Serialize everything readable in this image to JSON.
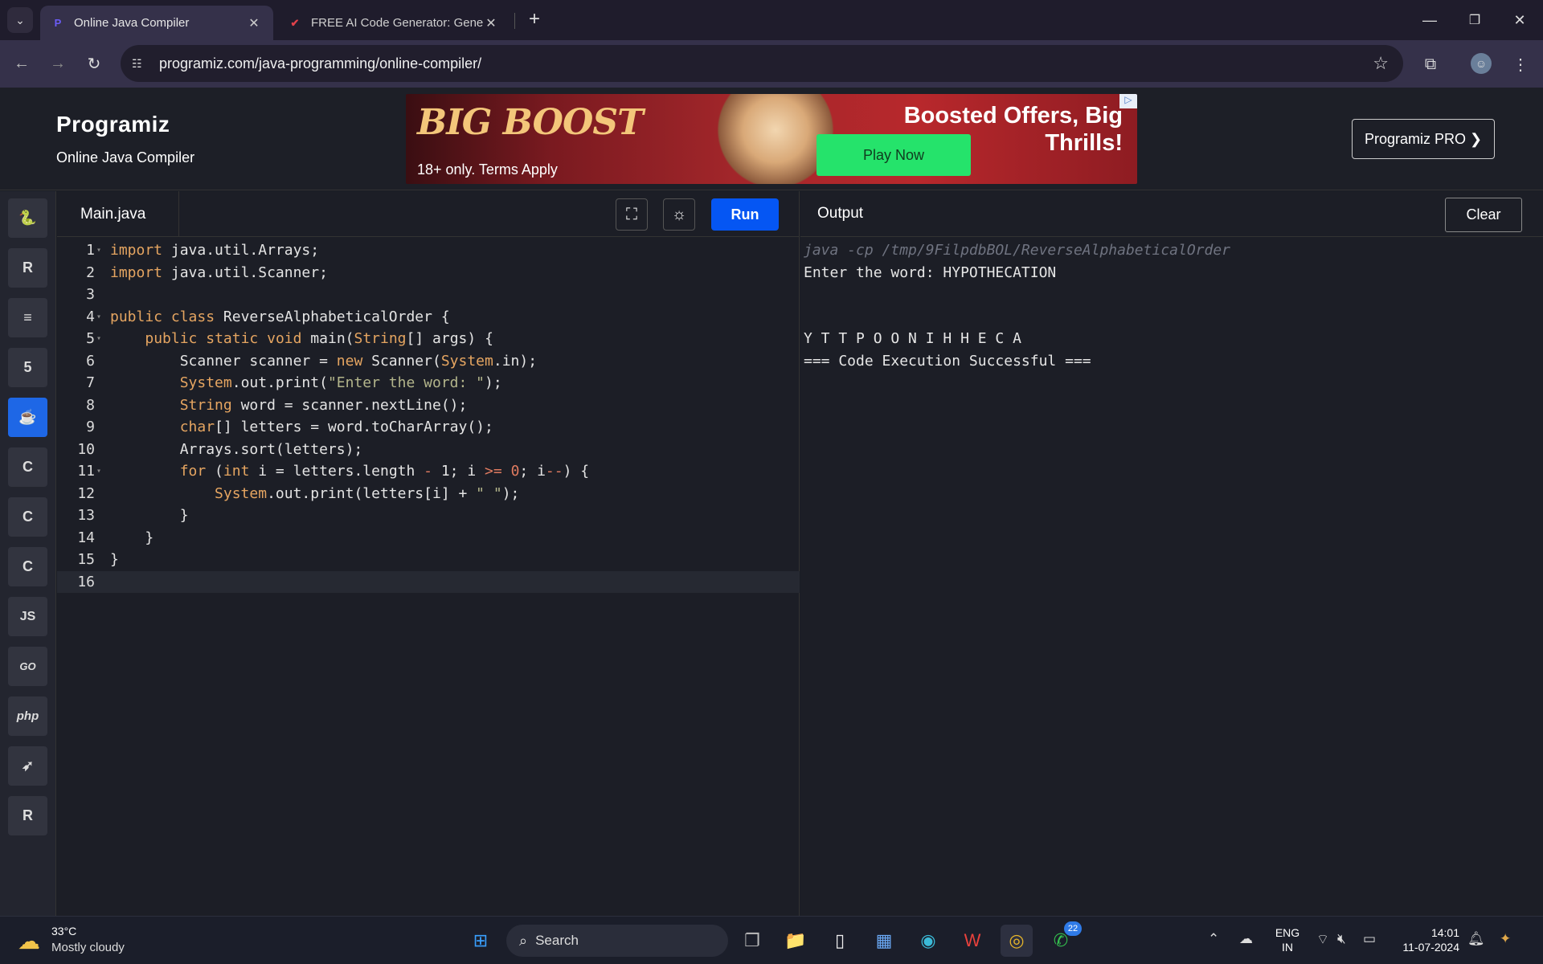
{
  "browser": {
    "tabs": [
      {
        "title": "Online Java Compiler"
      },
      {
        "title": "FREE AI Code Generator: Gener"
      }
    ],
    "new_tab": "+",
    "url": "programiz.com/java-programming/online-compiler/",
    "window_controls": {
      "minimize": "—",
      "restore": "❐",
      "close": "✕"
    }
  },
  "site": {
    "logo": "Programiz",
    "subtitle": "Online Java Compiler",
    "pro_button": "Programiz PRO ❯",
    "ad": {
      "brand": "BIG BOOST",
      "terms": "18+ only. Terms Apply",
      "cta": "Play Now",
      "headline": "Boosted Offers, Big Thrills!"
    }
  },
  "languages": [
    {
      "name": "python-icon",
      "glyph": "🐍"
    },
    {
      "name": "r-icon",
      "glyph": "R"
    },
    {
      "name": "sql-icon",
      "glyph": "≡"
    },
    {
      "name": "html-icon",
      "glyph": "5"
    },
    {
      "name": "java-icon",
      "glyph": "☕"
    },
    {
      "name": "c-icon",
      "glyph": "C"
    },
    {
      "name": "cpp-icon",
      "glyph": "C"
    },
    {
      "name": "csharp-icon",
      "glyph": "C"
    },
    {
      "name": "js-icon",
      "glyph": "JS"
    },
    {
      "name": "go-icon",
      "glyph": "GO"
    },
    {
      "name": "php-icon",
      "glyph": "php"
    },
    {
      "name": "swift-icon",
      "glyph": "➶"
    },
    {
      "name": "rust-icon",
      "glyph": "R"
    }
  ],
  "editor": {
    "file_tab": "Main.java",
    "run_label": "Run",
    "lines": [
      "import java.util.Arrays;",
      "import java.util.Scanner;",
      "",
      "public class ReverseAlphabeticalOrder {",
      "    public static void main(String[] args) {",
      "        Scanner scanner = new Scanner(System.in);",
      "        System.out.print(\"Enter the word: \");",
      "        String word = scanner.nextLine();",
      "        char[] letters = word.toCharArray();",
      "        Arrays.sort(letters);",
      "        for (int i = letters.length - 1; i >= 0; i--) {",
      "            System.out.print(letters[i] + \" \");",
      "        }",
      "    }",
      "}",
      ""
    ]
  },
  "output": {
    "title": "Output",
    "clear_label": "Clear",
    "lines": [
      "java -cp /tmp/9FilpdbBOL/ReverseAlphabeticalOrder",
      "Enter the word: HYPOTHECATION",
      "",
      "",
      "Y T T P O O N I H H E C A",
      "=== Code Execution Successful ==="
    ]
  },
  "taskbar": {
    "temperature": "33°C",
    "weather": "Mostly cloudy",
    "search_label": "Search",
    "whatsapp_badge": "22",
    "lang_top": "ENG",
    "lang_bottom": "IN",
    "time": "14:01",
    "date": "11-07-2024"
  }
}
